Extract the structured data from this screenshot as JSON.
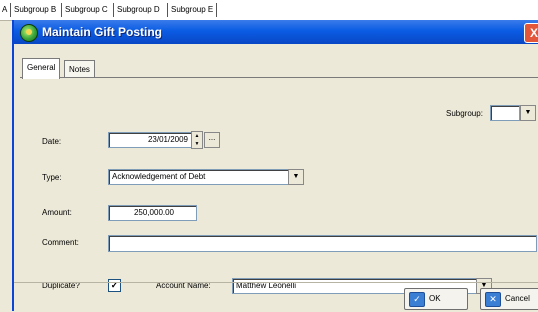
{
  "background_tabs": [
    "A",
    "Subgroup B",
    "Subgroup C",
    "Subgroup D",
    "Subgroup E"
  ],
  "window": {
    "title": "Maintain Gift Posting",
    "close_label": "X"
  },
  "tabs": [
    "General",
    "Notes"
  ],
  "form": {
    "subgroup_label": "Subgroup:",
    "subgroup_value": "",
    "date_label": "Date:",
    "date_value": "23/01/2009",
    "date_picker_label": "...",
    "type_label": "Type:",
    "type_value": "Acknowledgement of Debt",
    "amount_label": "Amount:",
    "amount_value": "250,000.00",
    "comment_label": "Comment:",
    "comment_value": "",
    "duplicate_label": "Duplicate?",
    "duplicate_checked": "✓",
    "account_name_label": "Account Name:",
    "account_name_value": "Matthew Leonelli"
  },
  "buttons": {
    "ok_label": "OK",
    "cancel_label": "Cancel"
  },
  "icons": {
    "dropdown": "▼",
    "spin_up": "▲",
    "spin_down": "▼",
    "ok_icon": "✓",
    "cancel_icon": "✕"
  },
  "colors": {
    "title_bar": "#0b5ce4",
    "window_bg": "#ece9d8",
    "close_button": "#e2563a"
  }
}
